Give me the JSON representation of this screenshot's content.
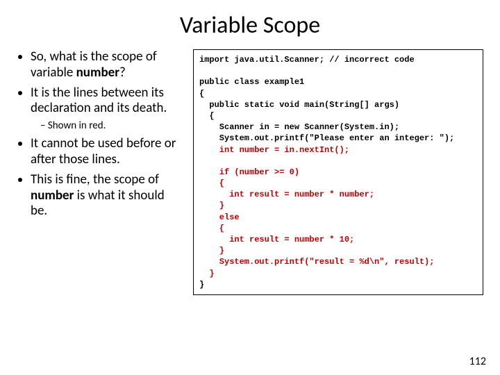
{
  "title": "Variable Scope",
  "bullets": {
    "b1_pre": "So, what is the scope of variable ",
    "b1_bold": "number",
    "b1_post": "?",
    "b2": "It is the lines between its declaration and its death.",
    "b2_sub": "Shown in red.",
    "b3": "It cannot be used before or after those lines.",
    "b4_pre": "This is fine, the scope of ",
    "b4_bold": "number",
    "b4_post": " is what it should be."
  },
  "code": {
    "l01": "import java.util.Scanner; // incorrect code",
    "l02": "",
    "l03": "public class example1",
    "l04": "{",
    "l05": "  public static void main(String[] args)",
    "l06": "  {",
    "l07": "    Scanner in = new Scanner(System.in);",
    "l08": "    System.out.printf(\"Please enter an integer: \");",
    "l09": "    int number = in.nextInt();",
    "l10": "",
    "l11": "    if (number >= 0)",
    "l12": "    {",
    "l13": "      int result = number * number;",
    "l14": "    }",
    "l15": "    else",
    "l16": "    {",
    "l17": "      int result = number * 10;",
    "l18": "    }",
    "l19": "    System.out.printf(\"result = %d\\n\", result);",
    "l20": "  }",
    "l21": "}"
  },
  "pagenum": "112"
}
